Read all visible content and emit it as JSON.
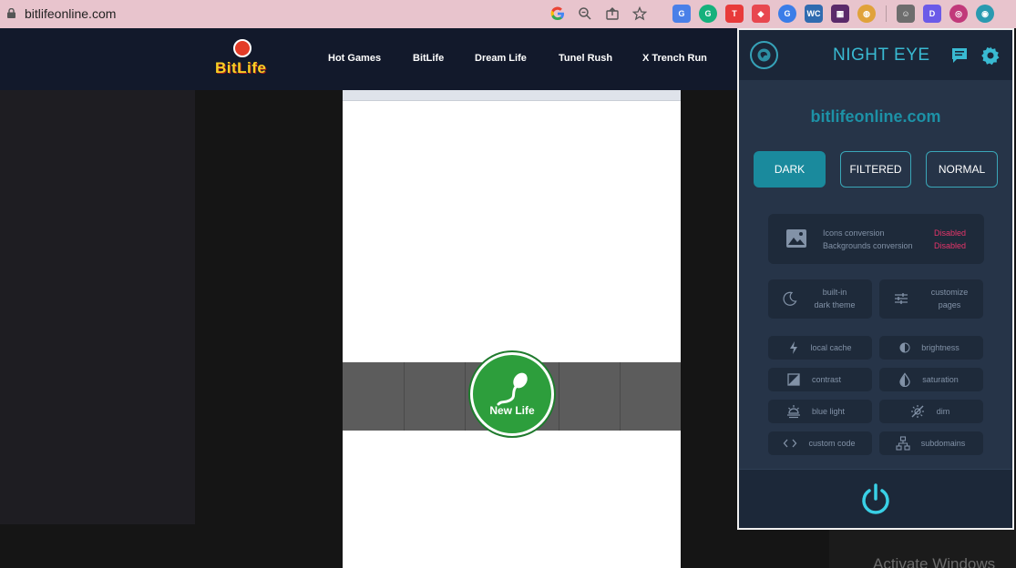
{
  "browser": {
    "url": "bitlifeonline.com",
    "toolbar_icons": [
      "google-icon",
      "zoom-icon",
      "share-icon",
      "star-icon"
    ],
    "extensions": [
      {
        "name": "translate-icon",
        "color": "#4a80e8",
        "glyph": "G"
      },
      {
        "name": "grammarly-icon",
        "color": "#15b17c",
        "glyph": "G"
      },
      {
        "name": "tube-icon",
        "color": "#e83a3a",
        "glyph": "T"
      },
      {
        "name": "dice-icon",
        "color": "#e8474f",
        "glyph": "◆"
      },
      {
        "name": "chat-ext-icon",
        "color": "#3a7de8",
        "glyph": "G"
      },
      {
        "name": "wc-icon",
        "color": "#2f6bb0",
        "glyph": "WC"
      },
      {
        "name": "grid-ext-icon",
        "color": "#5a2a6a",
        "glyph": "▦"
      },
      {
        "name": "chrome-ext-icon",
        "color": "#e0a23a",
        "glyph": "◍"
      },
      {
        "name": "robot-icon",
        "color": "#6d6d6d",
        "glyph": "☺"
      },
      {
        "name": "d-ext-icon",
        "color": "#6b5ae8",
        "glyph": "D"
      },
      {
        "name": "circle-ext-icon",
        "color": "#c1397a",
        "glyph": "◎"
      },
      {
        "name": "night-eye-ext-icon",
        "color": "#2a9ab0",
        "glyph": "◉"
      }
    ]
  },
  "site": {
    "logo": "BitLife",
    "nav": [
      "Hot Games",
      "BitLife",
      "Dream Life",
      "Tunel Rush",
      "X Trench Run"
    ]
  },
  "game": {
    "new_life_label": "New Life"
  },
  "overlay": {
    "activate_text": "Activate Windows"
  },
  "night_eye": {
    "title": "NIGHT EYE",
    "domain": "bitlifeonline.com",
    "modes": [
      {
        "label": "DARK",
        "active": true
      },
      {
        "label": "FILTERED",
        "active": false
      },
      {
        "label": "NORMAL",
        "active": false
      }
    ],
    "conversion": {
      "icons_label": "Icons conversion",
      "icons_value": "Disabled",
      "backgrounds_label": "Backgrounds conversion",
      "backgrounds_value": "Disabled"
    },
    "feature_tiles": [
      {
        "line1": "built-in",
        "line2": "dark theme",
        "icon": "moon-icon"
      },
      {
        "line1": "customize",
        "line2": "pages",
        "icon": "sliders-icon"
      }
    ],
    "tiles": [
      {
        "label": "local cache",
        "icon": "bolt-icon"
      },
      {
        "label": "brightness",
        "icon": "brightness-icon"
      },
      {
        "label": "contrast",
        "icon": "contrast-icon"
      },
      {
        "label": "saturation",
        "icon": "saturation-icon"
      },
      {
        "label": "blue light",
        "icon": "blue-light-icon"
      },
      {
        "label": "dim",
        "icon": "dim-icon"
      },
      {
        "label": "custom code",
        "icon": "code-icon"
      },
      {
        "label": "subdomains",
        "icon": "sitemap-icon"
      }
    ],
    "accent": "#39bad2",
    "disabled_color": "#e6356a"
  }
}
